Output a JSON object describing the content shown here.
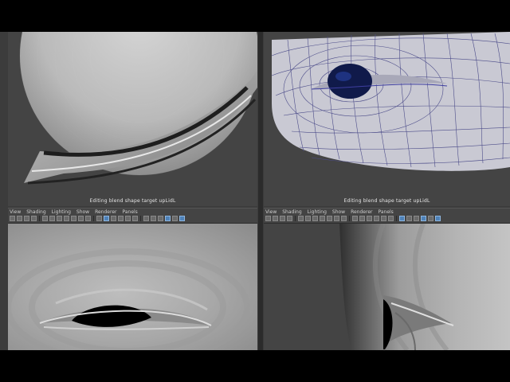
{
  "viewports": {
    "top_left": {
      "caption": "Editing blend shape target upLidL"
    },
    "top_right": {
      "caption": "Editing blend shape target upLidL"
    }
  },
  "panel_menus": {
    "left": [
      "View",
      "Shading",
      "Lighting",
      "Show",
      "Renderer",
      "Panels"
    ],
    "right": [
      "View",
      "Shading",
      "Lighting",
      "Show",
      "Renderer",
      "Panels"
    ]
  },
  "colors": {
    "viewport_bg": "#444444",
    "mesh_surface": "#c9c9d3",
    "wire": "#3e3ea0",
    "eyeball": "#101a4a",
    "selected_icon": "#4f82b8"
  }
}
